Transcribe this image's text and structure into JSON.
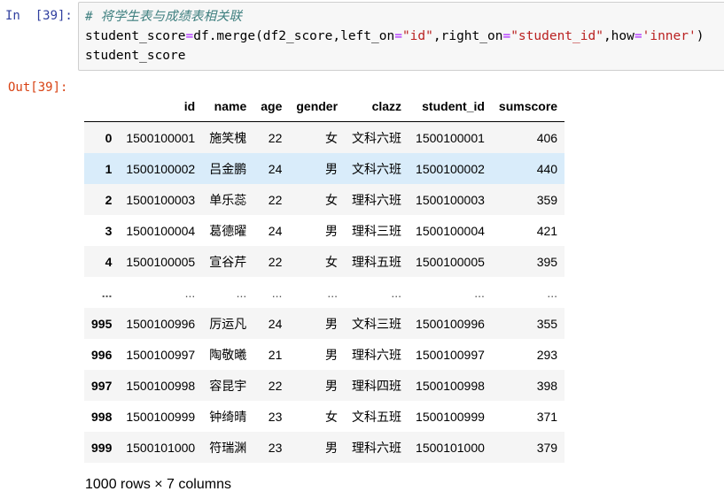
{
  "cell": {
    "in_prompt": "In  [39]:",
    "out_prompt": "Out[39]:",
    "code": {
      "comment": "# 将学生表与成绩表相关联",
      "line2": {
        "p1": "student_score",
        "eq1": "=",
        "p2": "df.merge(df2_score,left_on",
        "eq2": "=",
        "s1": "\"id\"",
        "p3": ",right_on",
        "eq3": "=",
        "s2": "\"student_id\"",
        "p4": ",how",
        "eq4": "=",
        "s3": "'inner'",
        "p5": ")"
      },
      "line3": "student_score"
    }
  },
  "dataframe": {
    "columns": [
      "",
      "id",
      "name",
      "age",
      "gender",
      "clazz",
      "student_id",
      "sumscore"
    ],
    "rows": [
      [
        "0",
        "1500100001",
        "施笑槐",
        "22",
        "女",
        "文科六班",
        "1500100001",
        "406"
      ],
      [
        "1",
        "1500100002",
        "吕金鹏",
        "24",
        "男",
        "文科六班",
        "1500100002",
        "440"
      ],
      [
        "2",
        "1500100003",
        "单乐蕊",
        "22",
        "女",
        "理科六班",
        "1500100003",
        "359"
      ],
      [
        "3",
        "1500100004",
        "葛德曜",
        "24",
        "男",
        "理科三班",
        "1500100004",
        "421"
      ],
      [
        "4",
        "1500100005",
        "宣谷芹",
        "22",
        "女",
        "理科五班",
        "1500100005",
        "395"
      ],
      [
        "...",
        "...",
        "...",
        "...",
        "...",
        "...",
        "...",
        "..."
      ],
      [
        "995",
        "1500100996",
        "厉运凡",
        "24",
        "男",
        "文科三班",
        "1500100996",
        "355"
      ],
      [
        "996",
        "1500100997",
        "陶敬曦",
        "21",
        "男",
        "理科六班",
        "1500100997",
        "293"
      ],
      [
        "997",
        "1500100998",
        "容昆宇",
        "22",
        "男",
        "理科四班",
        "1500100998",
        "398"
      ],
      [
        "998",
        "1500100999",
        "钟绮晴",
        "23",
        "女",
        "文科五班",
        "1500100999",
        "371"
      ],
      [
        "999",
        "1500101000",
        "符瑞渊",
        "23",
        "男",
        "理科六班",
        "1500101000",
        "379"
      ]
    ],
    "hover_row_index": 1,
    "shape": "1000 rows × 7 columns"
  }
}
